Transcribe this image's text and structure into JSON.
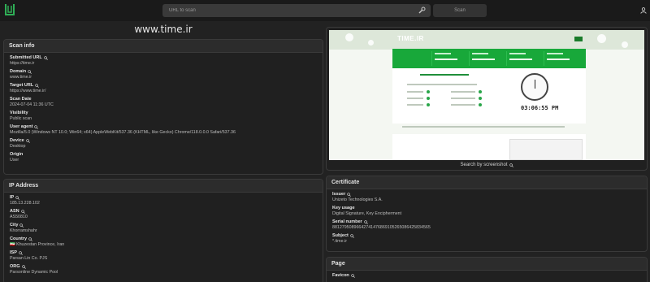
{
  "topbar": {
    "search_placeholder": "URL to scan",
    "scan_label": "Scan"
  },
  "page_title": "www.time.ir",
  "scan_info": {
    "title": "Scan info",
    "fields": [
      {
        "label": "Submitted URL",
        "value": "https://time.ir"
      },
      {
        "label": "Domain",
        "value": "www.time.ir"
      },
      {
        "label": "Target URL",
        "value": "https://www.time.ir/"
      },
      {
        "label": "Scan Date",
        "value": "2024-07-04 11:36 UTC"
      },
      {
        "label": "Visibility",
        "value": "Public scan"
      },
      {
        "label": "User agent",
        "value": "Mozilla/5.0 (Windows NT 10.0; Win64; x64) AppleWebKit/537.36 (KHTML, like Gecko) Chrome/118.0.0.0 Safari/537.36"
      },
      {
        "label": "Device",
        "value": "Desktop"
      },
      {
        "label": "Origin",
        "value": "User"
      }
    ]
  },
  "ip_address": {
    "title": "IP Address",
    "fields": [
      {
        "label": "IP",
        "value": "185.13.228.102"
      },
      {
        "label": "ASN",
        "value": "AS50810"
      },
      {
        "label": "City",
        "value": "Khorramshahr"
      },
      {
        "label": "Country",
        "value": "🇮🇷 Khuzestan Province, Iran"
      },
      {
        "label": "ISP",
        "value": "Parsan Lin Co. PJS"
      },
      {
        "label": "ORG",
        "value": "Parsonline Dynamic Pool"
      }
    ]
  },
  "screenshot": {
    "caption": "Search by screenshot",
    "site_logo": "TIME.IR",
    "site_time": "03:06:55 PM"
  },
  "certificate": {
    "title": "Certificate",
    "fields": [
      {
        "label": "Issuer",
        "value": "Unizeto Technologies S.A."
      },
      {
        "label": "Key usage",
        "value": "Digital Signature, Key Encipherment"
      },
      {
        "label": "Serial number",
        "value": "88127950896642741476869105265086425834565"
      },
      {
        "label": "Subject",
        "value": "*.time.ir"
      }
    ]
  },
  "page_card": {
    "title": "Page",
    "fields": [
      {
        "label": "Favicon",
        "value": ""
      }
    ]
  },
  "colors": {
    "background": "#222222",
    "card": "#202020",
    "card_header": "#2c2c2c",
    "accent": "#2fae56",
    "site_green": "#18a83a"
  },
  "icons": {
    "logo": "urlscan-logo-icon",
    "tool": "wrench-icon",
    "user": "user-icon",
    "search": "magnifier-icon"
  }
}
